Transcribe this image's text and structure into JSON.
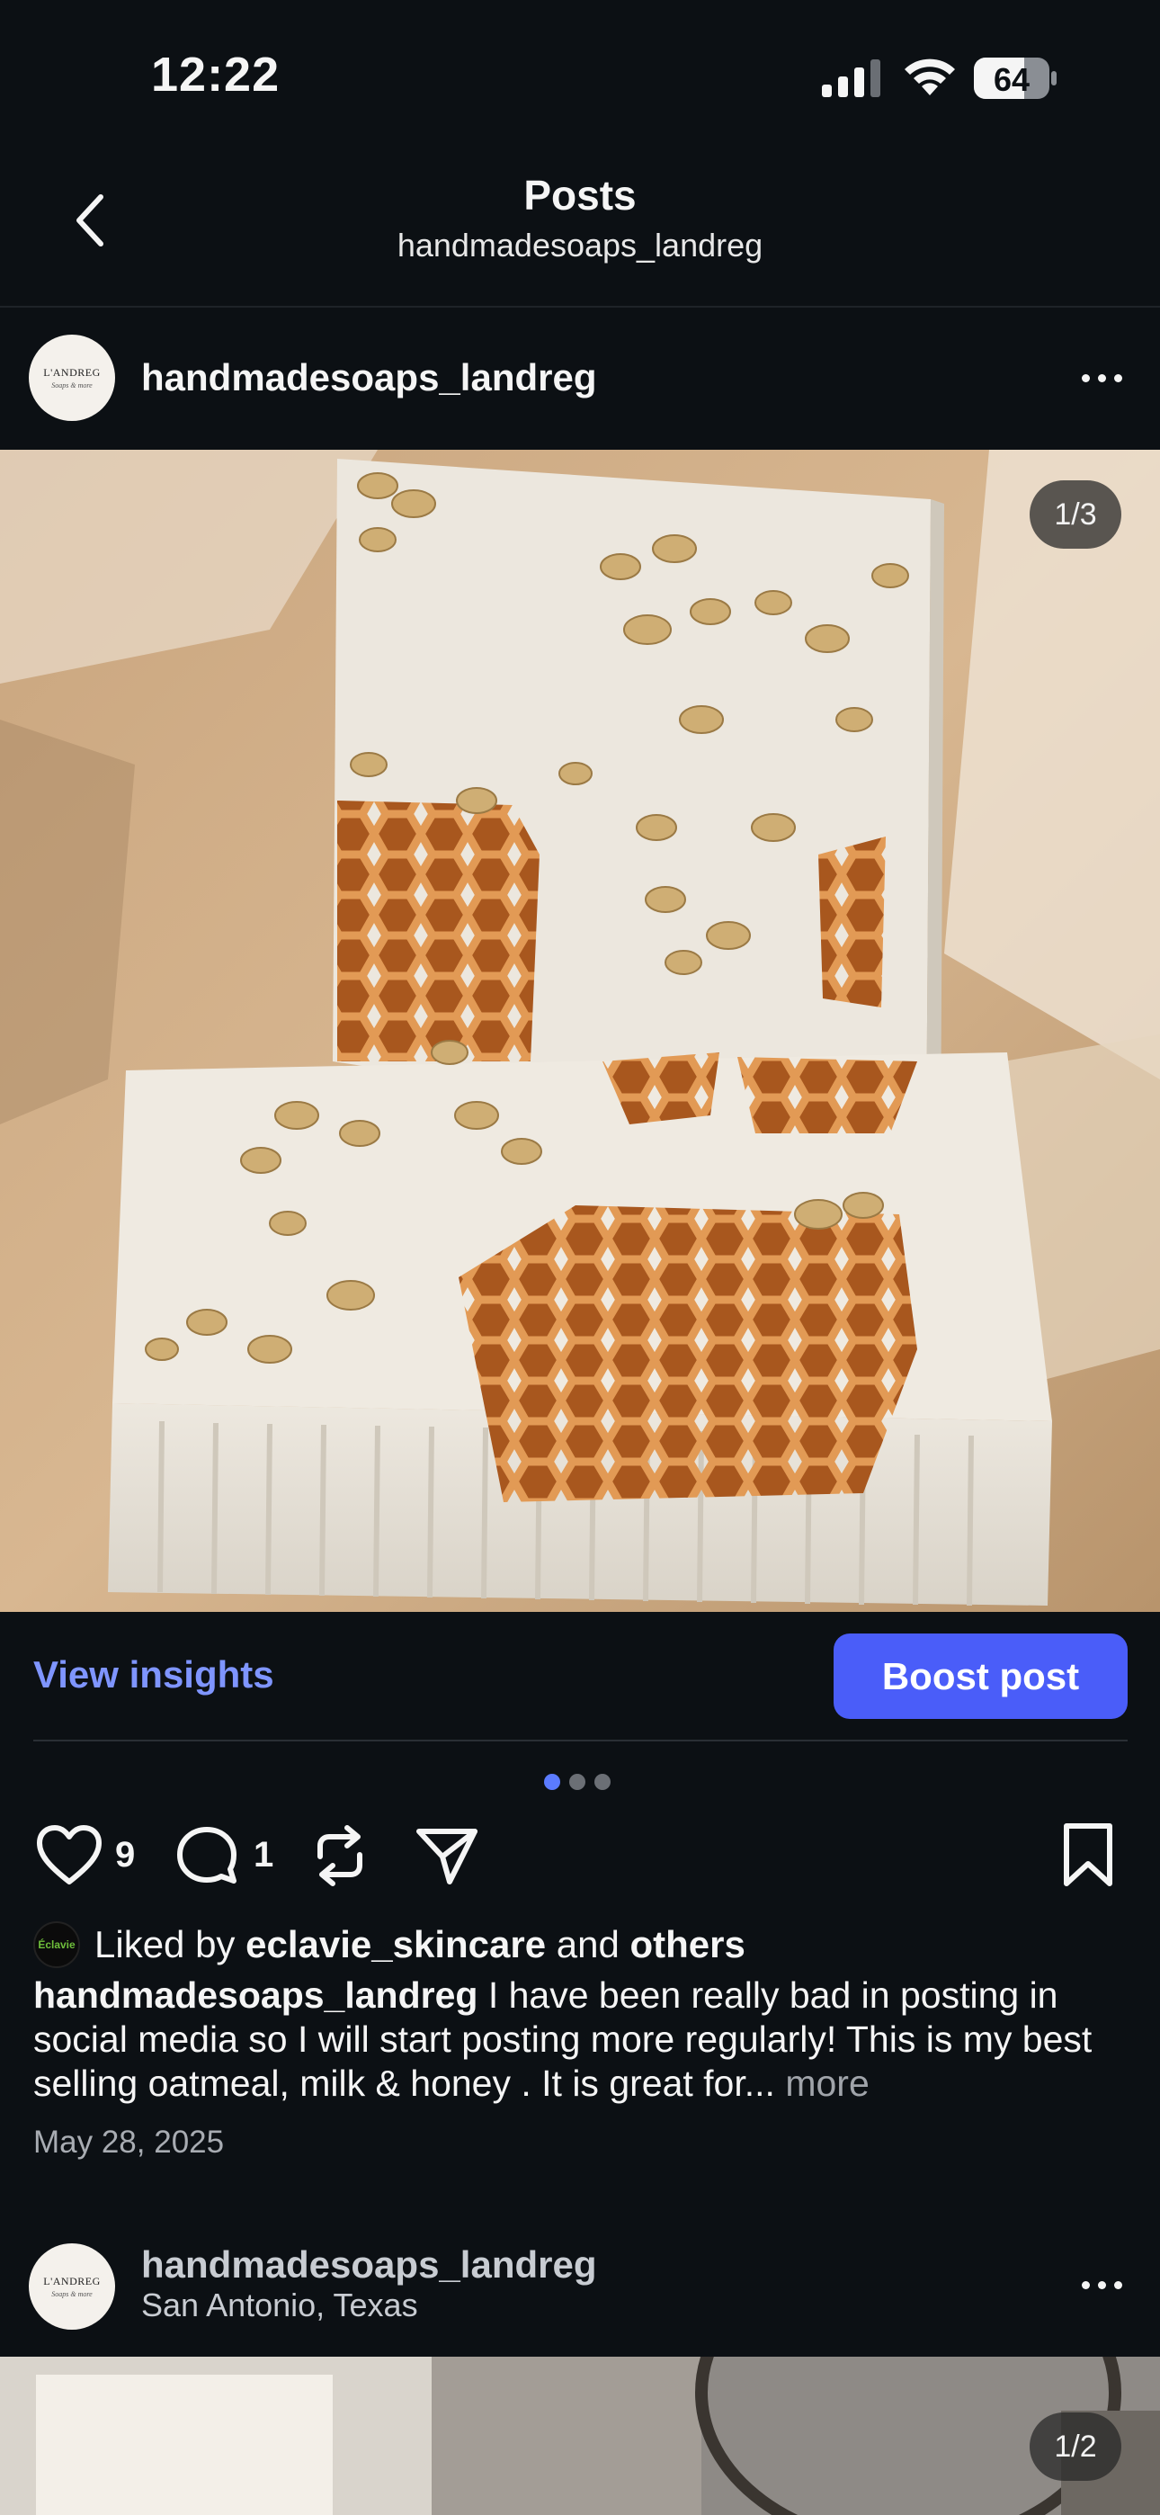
{
  "status_bar": {
    "time": "12:22",
    "battery": "64"
  },
  "header": {
    "title": "Posts",
    "subtitle": "handmadesoaps_landreg"
  },
  "post": {
    "username": "handmadesoaps_landreg",
    "avatar_logo": {
      "brand": "L'ANDREG",
      "tagline": "Soaps & more"
    },
    "image_counter": "1/3",
    "view_insights": "View insights",
    "boost_label": "Boost post",
    "carousel": {
      "count": 3,
      "active": 0
    },
    "likes_count": "9",
    "comments_count": "1",
    "liked_by": {
      "prefix": "Liked by",
      "user": "eclavie_skincare",
      "joiner": "and",
      "others": "others",
      "avatar_text": "Éclavie"
    },
    "caption": {
      "username": "handmadesoaps_landreg",
      "text": " I have been really bad in posting in social media so I will start posting more regularly!  This is my best selling oatmeal, milk & honey . It is great for...",
      "more": "more"
    },
    "date": "May 28, 2025"
  },
  "next_post": {
    "username": "handmadesoaps_landreg",
    "location": "San Antonio, Texas",
    "image_counter": "1/2"
  },
  "colors": {
    "background": "#0c1014",
    "accent_link": "#7f95ff",
    "boost_button": "#4a5df9",
    "carousel_active": "#5b7bff"
  }
}
